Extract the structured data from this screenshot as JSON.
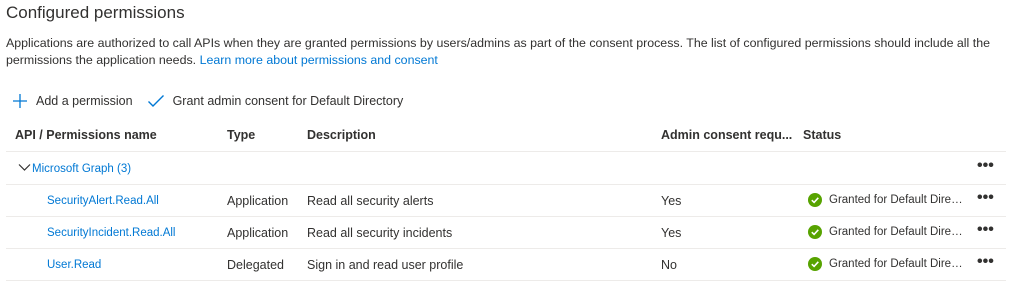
{
  "section": {
    "title": "Configured permissions",
    "description": "Applications are authorized to call APIs when they are granted permissions by users/admins as part of the consent process. The list of configured permissions should include all the permissions the application needs.",
    "learn_more": "Learn more about permissions and consent"
  },
  "toolbar": {
    "add_permission": "Add a permission",
    "grant_consent": "Grant admin consent for Default Directory"
  },
  "table": {
    "headers": {
      "api": "API / Permissions name",
      "type": "Type",
      "description": "Description",
      "admin_consent": "Admin consent requ...",
      "status": "Status"
    },
    "group": {
      "name": "Microsoft Graph (3)",
      "more": "•••"
    },
    "rows": [
      {
        "name": "SecurityAlert.Read.All",
        "type": "Application",
        "description": "Read all security alerts",
        "admin_consent": "Yes",
        "status": "Granted for Default Directory",
        "more": "•••"
      },
      {
        "name": "SecurityIncident.Read.All",
        "type": "Application",
        "description": "Read all security incidents",
        "admin_consent": "Yes",
        "status": "Granted for Default Directory",
        "more": "•••"
      },
      {
        "name": "User.Read",
        "type": "Delegated",
        "description": "Sign in and read user profile",
        "admin_consent": "No",
        "status": "Granted for Default Directory",
        "more": "•••"
      }
    ]
  },
  "colors": {
    "link": "#0078d4",
    "success": "#57a300",
    "border": "#edebe9",
    "text": "#323130"
  },
  "icons": {
    "add": "plus-icon",
    "grant": "checkmark-icon",
    "expand": "chevron-down-icon",
    "status": "check-circle-icon",
    "more": "more-icon"
  }
}
